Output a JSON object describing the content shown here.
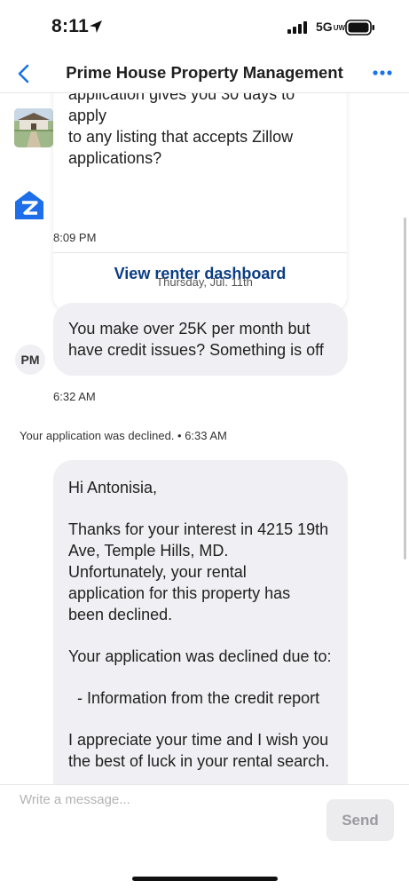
{
  "status_bar": {
    "time": "8:11",
    "network": "5G",
    "network_sub": "UW"
  },
  "header": {
    "title": "Prime House Property Management",
    "back_icon": "chevron-left-icon",
    "more_icon": "ellipsis-icon"
  },
  "card": {
    "lines": [
      "application gives you 30 days to apply",
      "to any listing that accepts Zillow",
      "applications?"
    ],
    "link_label": "View renter dashboard",
    "timestamp": "8:09 PM"
  },
  "date_separator": "Thursday, Jul. 11th",
  "incoming_message": {
    "avatar_initials": "PM",
    "lines": [
      "You make over 25K per month but",
      "have credit issues? Something is off"
    ],
    "timestamp": "6:32 AM"
  },
  "system_notice": "Your application was declined. • 6:33 AM",
  "decline_message": {
    "greeting": "Hi Antonisia,",
    "body1_lines": [
      "Thanks for your interest in 4215 19th",
      "Ave, Temple Hills, MD.",
      "Unfortunately, your rental",
      "application for this property has",
      "been declined."
    ],
    "reason_intro": "Your application was declined due to:",
    "reason_item": "  - Information from the credit report",
    "closing_lines": [
      "I appreciate your time and I wish you",
      "the best of luck in your rental search."
    ]
  },
  "compose": {
    "placeholder": "Write a message...",
    "send_label": "Send"
  },
  "colors": {
    "link_blue": "#0b3d84",
    "ios_blue": "#1a73e8",
    "bubble_gray": "#f0f0f4"
  }
}
